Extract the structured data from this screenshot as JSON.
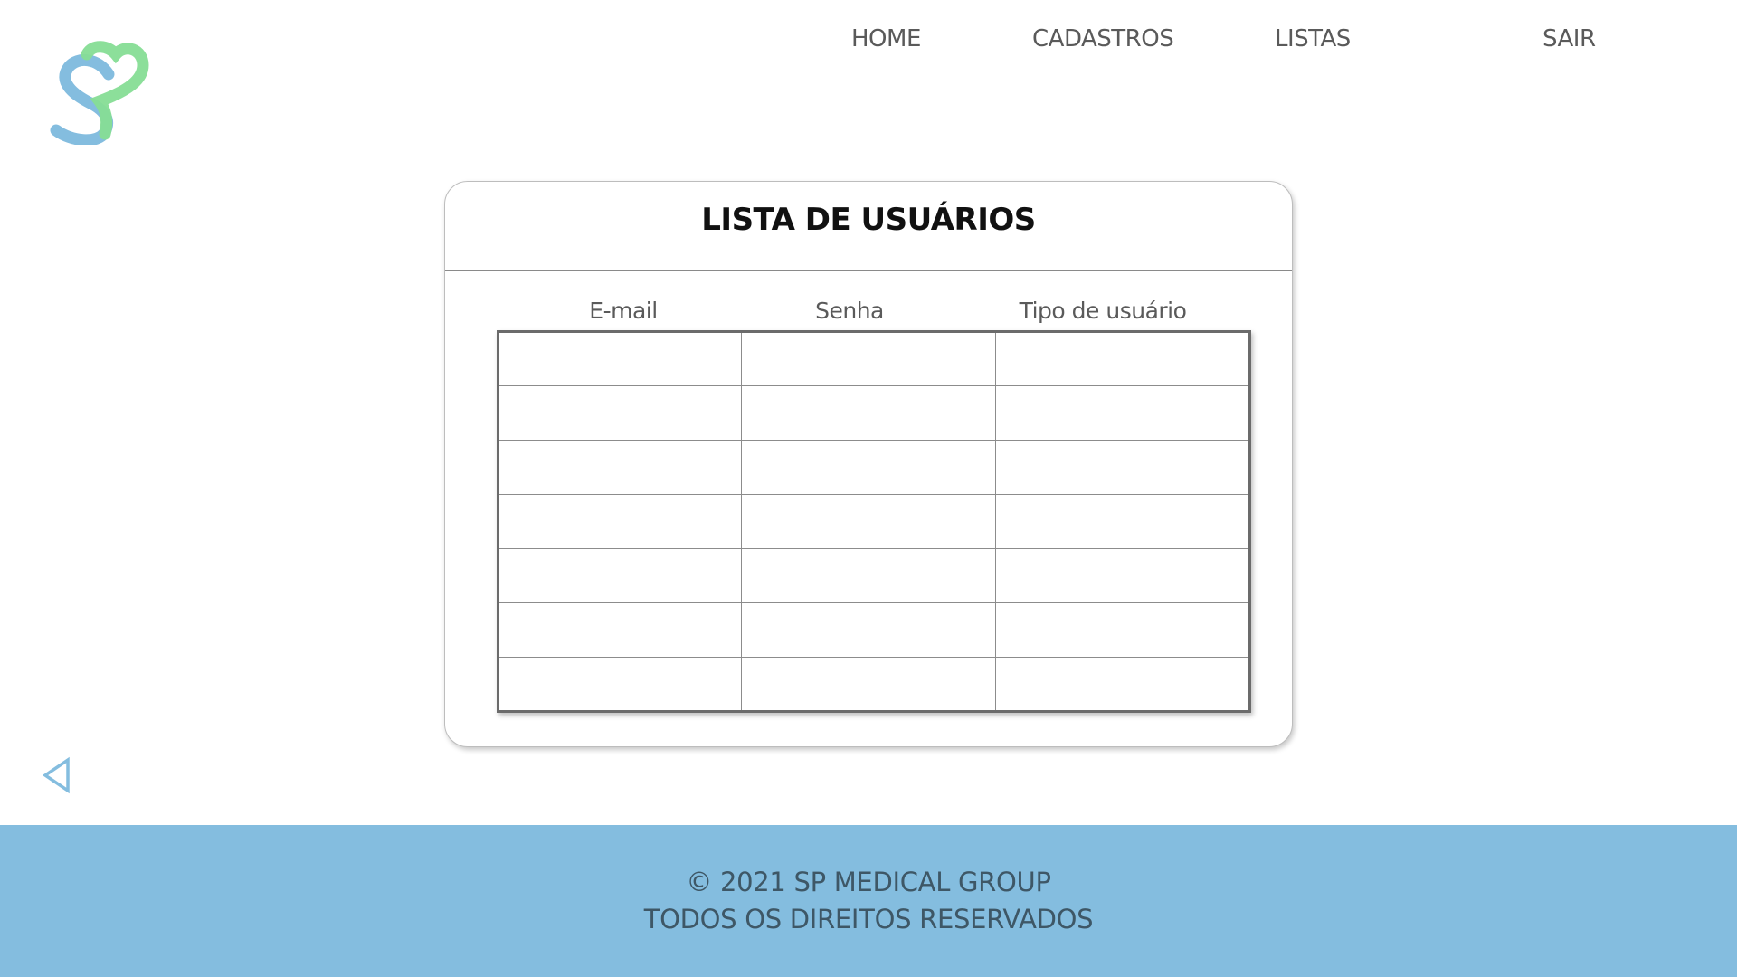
{
  "nav": {
    "items": [
      {
        "label": "HOME"
      },
      {
        "label": "CADASTROS"
      },
      {
        "label": "LISTAS"
      },
      {
        "label": "SAIR"
      }
    ]
  },
  "logo": {
    "icon": "sp-medical-heart-logo",
    "colors": [
      "#84bddf",
      "#86dd95"
    ]
  },
  "main": {
    "title": "LISTA DE USUÁRIOS",
    "table": {
      "headers": [
        "E-mail",
        "Senha",
        "Tipo de usuário"
      ],
      "rows": [
        [
          "",
          "",
          ""
        ],
        [
          "",
          "",
          ""
        ],
        [
          "",
          "",
          ""
        ],
        [
          "",
          "",
          ""
        ],
        [
          "",
          "",
          ""
        ],
        [
          "",
          "",
          ""
        ],
        [
          "",
          "",
          ""
        ]
      ]
    }
  },
  "back": {
    "icon": "back-arrow-icon",
    "color": "#84bddf"
  },
  "footer": {
    "line1": "© 2021 SP MEDICAL GROUP",
    "line2": "TODOS OS DIREITOS RESERVADOS",
    "background": "#84bddf"
  }
}
